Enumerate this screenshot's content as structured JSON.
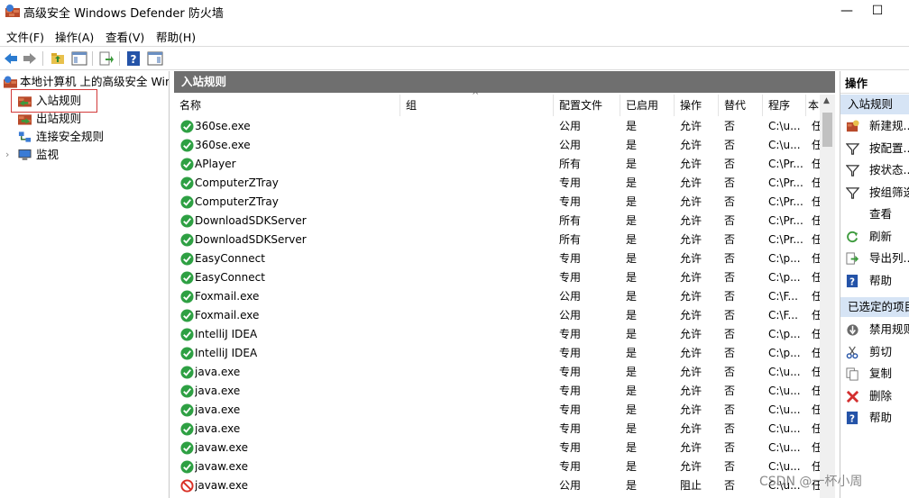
{
  "window": {
    "title": "高级安全 Windows Defender 防火墙",
    "minimize": "—",
    "maximize": "☐"
  },
  "menu": [
    "文件(F)",
    "操作(A)",
    "查看(V)",
    "帮助(H)"
  ],
  "tree": {
    "root": "本地计算机 上的高级安全 Wind",
    "items": [
      {
        "label": "入站规则"
      },
      {
        "label": "出站规则"
      },
      {
        "label": "连接安全规则"
      },
      {
        "label": "监视"
      }
    ]
  },
  "center": {
    "header": "入站规则",
    "columns": [
      "名称",
      "组",
      "配置文件",
      "已启用",
      "操作",
      "替代",
      "程序",
      "本"
    ],
    "rows": [
      {
        "name": "360se.exe",
        "group": "",
        "profile": "公用",
        "enabled": "是",
        "action": "允许",
        "override": "否",
        "program": "C:\\u...",
        "local": "任",
        "status": "allow"
      },
      {
        "name": "360se.exe",
        "group": "",
        "profile": "公用",
        "enabled": "是",
        "action": "允许",
        "override": "否",
        "program": "C:\\u...",
        "local": "任",
        "status": "allow"
      },
      {
        "name": "APlayer",
        "group": "",
        "profile": "所有",
        "enabled": "是",
        "action": "允许",
        "override": "否",
        "program": "C:\\Pr...",
        "local": "任",
        "status": "allow"
      },
      {
        "name": "ComputerZTray",
        "group": "",
        "profile": "专用",
        "enabled": "是",
        "action": "允许",
        "override": "否",
        "program": "C:\\Pr...",
        "local": "任",
        "status": "allow"
      },
      {
        "name": "ComputerZTray",
        "group": "",
        "profile": "专用",
        "enabled": "是",
        "action": "允许",
        "override": "否",
        "program": "C:\\Pr...",
        "local": "任",
        "status": "allow"
      },
      {
        "name": "DownloadSDKServer",
        "group": "",
        "profile": "所有",
        "enabled": "是",
        "action": "允许",
        "override": "否",
        "program": "C:\\Pr...",
        "local": "任",
        "status": "allow"
      },
      {
        "name": "DownloadSDKServer",
        "group": "",
        "profile": "所有",
        "enabled": "是",
        "action": "允许",
        "override": "否",
        "program": "C:\\Pr...",
        "local": "任",
        "status": "allow"
      },
      {
        "name": "EasyConnect",
        "group": "",
        "profile": "专用",
        "enabled": "是",
        "action": "允许",
        "override": "否",
        "program": "C:\\p...",
        "local": "任",
        "status": "allow"
      },
      {
        "name": "EasyConnect",
        "group": "",
        "profile": "专用",
        "enabled": "是",
        "action": "允许",
        "override": "否",
        "program": "C:\\p...",
        "local": "任",
        "status": "allow"
      },
      {
        "name": "Foxmail.exe",
        "group": "",
        "profile": "公用",
        "enabled": "是",
        "action": "允许",
        "override": "否",
        "program": "C:\\F...",
        "local": "任",
        "status": "allow"
      },
      {
        "name": "Foxmail.exe",
        "group": "",
        "profile": "公用",
        "enabled": "是",
        "action": "允许",
        "override": "否",
        "program": "C:\\F...",
        "local": "任",
        "status": "allow"
      },
      {
        "name": "IntelliJ IDEA",
        "group": "",
        "profile": "专用",
        "enabled": "是",
        "action": "允许",
        "override": "否",
        "program": "C:\\p...",
        "local": "任",
        "status": "allow"
      },
      {
        "name": "IntelliJ IDEA",
        "group": "",
        "profile": "专用",
        "enabled": "是",
        "action": "允许",
        "override": "否",
        "program": "C:\\p...",
        "local": "任",
        "status": "allow"
      },
      {
        "name": "java.exe",
        "group": "",
        "profile": "专用",
        "enabled": "是",
        "action": "允许",
        "override": "否",
        "program": "C:\\u...",
        "local": "任",
        "status": "allow"
      },
      {
        "name": "java.exe",
        "group": "",
        "profile": "专用",
        "enabled": "是",
        "action": "允许",
        "override": "否",
        "program": "C:\\u...",
        "local": "任",
        "status": "allow"
      },
      {
        "name": "java.exe",
        "group": "",
        "profile": "专用",
        "enabled": "是",
        "action": "允许",
        "override": "否",
        "program": "C:\\u...",
        "local": "任",
        "status": "allow"
      },
      {
        "name": "java.exe",
        "group": "",
        "profile": "专用",
        "enabled": "是",
        "action": "允许",
        "override": "否",
        "program": "C:\\u...",
        "local": "任",
        "status": "allow"
      },
      {
        "name": "javaw.exe",
        "group": "",
        "profile": "专用",
        "enabled": "是",
        "action": "允许",
        "override": "否",
        "program": "C:\\u...",
        "local": "任",
        "status": "allow"
      },
      {
        "name": "javaw.exe",
        "group": "",
        "profile": "专用",
        "enabled": "是",
        "action": "允许",
        "override": "否",
        "program": "C:\\u...",
        "local": "任",
        "status": "allow"
      },
      {
        "name": "javaw.exe",
        "group": "",
        "profile": "公用",
        "enabled": "是",
        "action": "阻止",
        "override": "否",
        "program": "C:\\u...",
        "local": "任",
        "status": "block"
      }
    ]
  },
  "actions": {
    "title": "操作",
    "section1": "入站规则",
    "section1_items": [
      {
        "label": "新建规...",
        "icon": "new-rule-icon"
      },
      {
        "label": "按配置...",
        "icon": "filter-icon"
      },
      {
        "label": "按状态...",
        "icon": "filter-icon"
      },
      {
        "label": "按组筛选",
        "icon": "filter-icon"
      },
      {
        "label": "查看",
        "icon": ""
      },
      {
        "label": "刷新",
        "icon": "refresh-icon"
      },
      {
        "label": "导出列...",
        "icon": "export-icon"
      },
      {
        "label": "帮助",
        "icon": "help-icon"
      }
    ],
    "section2": "已选定的项目",
    "section2_items": [
      {
        "label": "禁用规则",
        "icon": "disable-icon"
      },
      {
        "label": "剪切",
        "icon": "cut-icon"
      },
      {
        "label": "复制",
        "icon": "copy-icon"
      },
      {
        "label": "删除",
        "icon": "delete-icon"
      },
      {
        "label": "帮助",
        "icon": "help-icon"
      }
    ]
  },
  "watermark": "CSDN @一杯小周",
  "colors": {
    "header_bg": "#6f6f6f",
    "section_bg": "#d6e4f5",
    "allow_green": "#2ea043",
    "block_red": "#d93025",
    "selection_border": "#d23a3a"
  }
}
